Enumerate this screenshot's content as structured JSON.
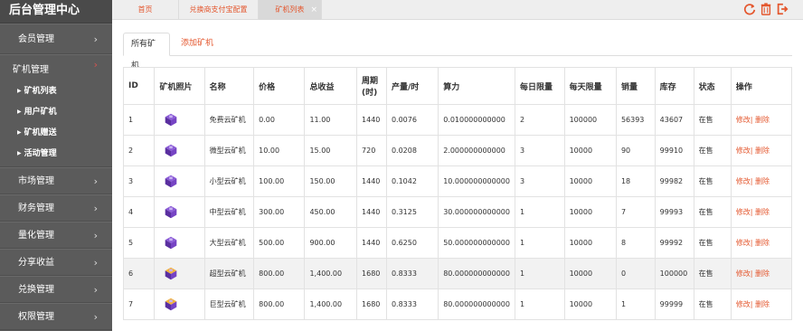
{
  "sidebar": {
    "brand": "后台管理中心",
    "menu": [
      {
        "label": "会员管理"
      },
      {
        "label": "矿机管理"
      },
      {
        "label": "市场管理"
      },
      {
        "label": "财务管理"
      },
      {
        "label": "量化管理"
      },
      {
        "label": "分享收益"
      },
      {
        "label": "兑换管理"
      },
      {
        "label": "权限管理"
      }
    ],
    "submenu": [
      {
        "label": "矿机列表"
      },
      {
        "label": "用户矿机"
      },
      {
        "label": "矿机赠送"
      },
      {
        "label": "活动管理"
      }
    ],
    "chevron": "›"
  },
  "tabbar": {
    "tabs": [
      {
        "label": "首页"
      },
      {
        "label": "兑换商支付宝配置"
      },
      {
        "label": "矿机列表"
      }
    ],
    "close": "×"
  },
  "content": {
    "tabs": [
      {
        "label": "所有矿机"
      },
      {
        "label": "添加矿机"
      }
    ],
    "table": {
      "headers": [
        "ID",
        "矿机照片",
        "名称",
        "价格",
        "总收益",
        "周期\n(时)",
        "产量/时",
        "算力",
        "每日限量",
        "每天限量",
        "销量",
        "库存",
        "状态",
        "操作"
      ],
      "rows": [
        [
          "1",
          "",
          "免费云矿机",
          "0.00",
          "11.00",
          "1440",
          "0.0076",
          "0.010000000000",
          "2",
          "100000",
          "56393",
          "43607",
          "在售",
          "修改| 删除"
        ],
        [
          "2",
          "",
          "微型云矿机",
          "10.00",
          "15.00",
          "720",
          "0.0208",
          "2.000000000000",
          "3",
          "10000",
          "90",
          "99910",
          "在售",
          "修改| 删除"
        ],
        [
          "3",
          "",
          "小型云矿机",
          "100.00",
          "150.00",
          "1440",
          "0.1042",
          "10.000000000000",
          "3",
          "10000",
          "18",
          "99982",
          "在售",
          "修改| 删除"
        ],
        [
          "4",
          "",
          "中型云矿机",
          "300.00",
          "450.00",
          "1440",
          "0.3125",
          "30.000000000000",
          "1",
          "10000",
          "7",
          "99993",
          "在售",
          "修改| 删除"
        ],
        [
          "5",
          "",
          "大型云矿机",
          "500.00",
          "900.00",
          "1440",
          "0.6250",
          "50.000000000000",
          "1",
          "10000",
          "8",
          "99992",
          "在售",
          "修改| 删除"
        ],
        [
          "6",
          "",
          "超型云矿机",
          "800.00",
          "1,400.00",
          "1680",
          "0.8333",
          "80.000000000000",
          "1",
          "10000",
          "0",
          "100000",
          "在售",
          "修改| 删除"
        ],
        [
          "7",
          "",
          "巨型云矿机",
          "800.00",
          "1,400.00",
          "1680",
          "0.8333",
          "80.000000000000",
          "1",
          "10000",
          "1",
          "99999",
          "在售",
          "修改| 删除"
        ]
      ]
    }
  },
  "colors": {
    "accent": "#e4572e",
    "sidebar_bg": "#5b5b5b",
    "icon_purple": "#6a3fb5",
    "icon_orange": "#f0a030"
  },
  "icons": [
    "refresh-icon",
    "trash-icon",
    "logout-icon",
    "close-icon",
    "chevron-right-icon",
    "miner-icon"
  ]
}
